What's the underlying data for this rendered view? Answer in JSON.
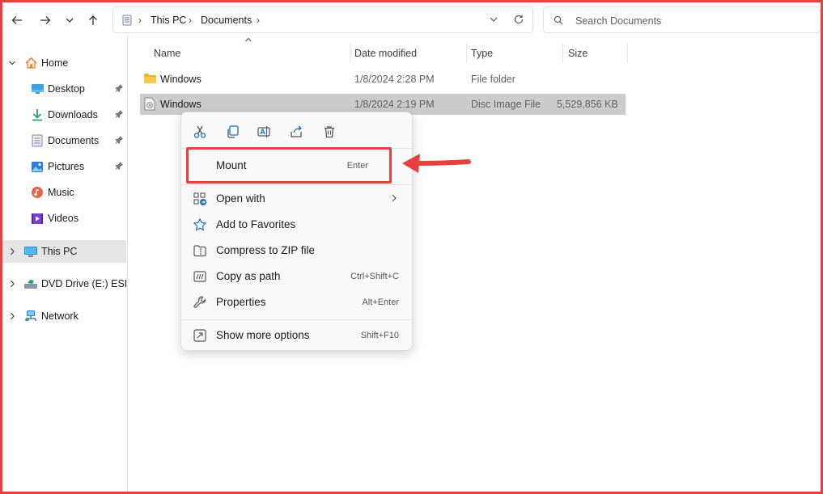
{
  "toolbar": {
    "breadcrumb": [
      "This PC",
      "Documents"
    ],
    "search_placeholder": "Search Documents"
  },
  "sidebar": {
    "items": [
      {
        "label": "Home",
        "icon": "home-icon"
      },
      {
        "label": "Desktop",
        "icon": "desktop-icon",
        "pinned": true
      },
      {
        "label": "Downloads",
        "icon": "download-icon",
        "pinned": true
      },
      {
        "label": "Documents",
        "icon": "documents-icon",
        "pinned": true
      },
      {
        "label": "Pictures",
        "icon": "pictures-icon",
        "pinned": true
      },
      {
        "label": "Music",
        "icon": "music-icon"
      },
      {
        "label": "Videos",
        "icon": "videos-icon"
      },
      {
        "label": "This PC",
        "icon": "this-pc-icon",
        "selected": true
      },
      {
        "label": "DVD Drive (E:) ESD-I",
        "icon": "dvd-drive-icon"
      },
      {
        "label": "Network",
        "icon": "network-icon"
      }
    ]
  },
  "file_list": {
    "columns": [
      "Name",
      "Date modified",
      "Type",
      "Size"
    ],
    "rows": [
      {
        "name": "Windows",
        "date": "1/8/2024 2:28 PM",
        "type": "File folder",
        "size": "",
        "icon": "folder-icon"
      },
      {
        "name": "Windows",
        "date": "1/8/2024 2:19 PM",
        "type": "Disc Image File",
        "size": "5,529,856 KB",
        "icon": "disc-image-icon",
        "selected": true
      }
    ]
  },
  "context_menu": {
    "quick_actions": [
      "cut-icon",
      "copy-icon",
      "rename-icon",
      "share-icon",
      "delete-icon"
    ],
    "items": [
      {
        "label": "Mount",
        "shortcut": "Enter"
      },
      {
        "label": "Open with",
        "shortcut": ""
      },
      {
        "label": "Add to Favorites",
        "shortcut": ""
      },
      {
        "label": "Compress to ZIP file",
        "shortcut": ""
      },
      {
        "label": "Copy as path",
        "shortcut": "Ctrl+Shift+C"
      },
      {
        "label": "Properties",
        "shortcut": "Alt+Enter"
      },
      {
        "label": "Show more options",
        "shortcut": "Shift+F10"
      }
    ]
  },
  "colors": {
    "highlight": "#e8403f",
    "selection": "#cccccc",
    "sidebar_selected": "#e5e5e5",
    "accent_blue": "#2b6fd6",
    "folder_yellow": "#f7c948"
  }
}
